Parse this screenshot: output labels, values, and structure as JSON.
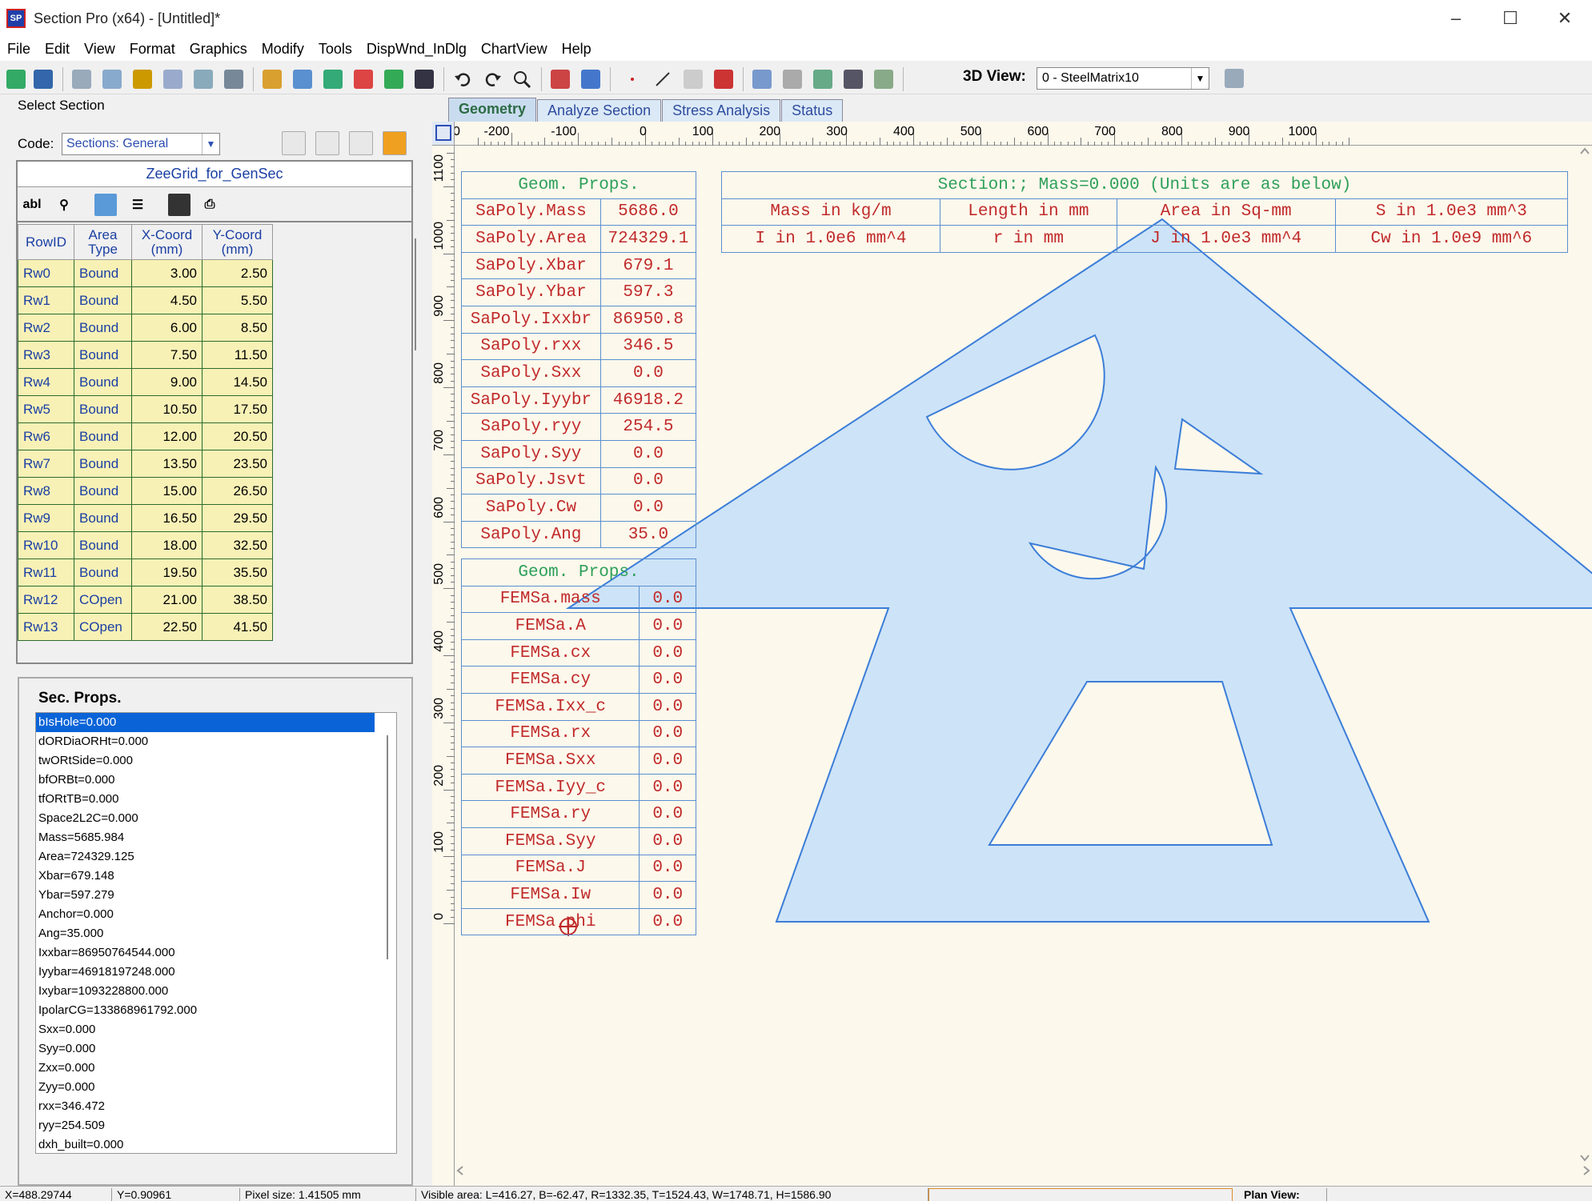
{
  "window": {
    "title": "Section Pro (x64) - [Untitled]*",
    "app_icon_text": "SP"
  },
  "menu": [
    "File",
    "Edit",
    "View",
    "Format",
    "Graphics",
    "Modify",
    "Tools",
    "DispWnd_InDlg",
    "ChartView",
    "Help"
  ],
  "toolbar": {
    "view3d_label": "3D View:",
    "view3d_value": "0 - SteelMatrix10"
  },
  "left": {
    "select_section": "Select Section",
    "code_label": "Code:",
    "code_value": "Sections: General",
    "grid_title": "ZeeGrid_for_GenSec",
    "grid_tool_text": "abl",
    "columns": [
      "RowID",
      "Area Type",
      "X-Coord (mm)",
      "Y-Coord (mm)"
    ],
    "rows": [
      [
        "Rw0",
        "Bound",
        "3.00",
        "2.50"
      ],
      [
        "Rw1",
        "Bound",
        "4.50",
        "5.50"
      ],
      [
        "Rw2",
        "Bound",
        "6.00",
        "8.50"
      ],
      [
        "Rw3",
        "Bound",
        "7.50",
        "11.50"
      ],
      [
        "Rw4",
        "Bound",
        "9.00",
        "14.50"
      ],
      [
        "Rw5",
        "Bound",
        "10.50",
        "17.50"
      ],
      [
        "Rw6",
        "Bound",
        "12.00",
        "20.50"
      ],
      [
        "Rw7",
        "Bound",
        "13.50",
        "23.50"
      ],
      [
        "Rw8",
        "Bound",
        "15.00",
        "26.50"
      ],
      [
        "Rw9",
        "Bound",
        "16.50",
        "29.50"
      ],
      [
        "Rw10",
        "Bound",
        "18.00",
        "32.50"
      ],
      [
        "Rw11",
        "Bound",
        "19.50",
        "35.50"
      ],
      [
        "Rw12",
        "COpen",
        "21.00",
        "38.50"
      ],
      [
        "Rw13",
        "COpen",
        "22.50",
        "41.50"
      ]
    ],
    "sec_props_title": "Sec. Props.",
    "sec_props": [
      "bIsHole=0.000",
      "dORDiaORHt=0.000",
      "twORtSide=0.000",
      "bfORBt=0.000",
      "tfORtTB=0.000",
      "Space2L2C=0.000",
      "Mass=5685.984",
      "Area=724329.125",
      "Xbar=679.148",
      "Ybar=597.279",
      "Anchor=0.000",
      "Ang=35.000",
      "Ixxbar=86950764544.000",
      "Iyybar=46918197248.000",
      "Ixybar=1093228800.000",
      "IpolarCG=133868961792.000",
      "Sxx=0.000",
      "Syy=0.000",
      "Zxx=0.000",
      "Zyy=0.000",
      "rxx=346.472",
      "ryy=254.509",
      "dxh_built=0.000"
    ]
  },
  "tabs": [
    "Geometry",
    "Analyze Section",
    "Stress Analysis",
    "Status"
  ],
  "ruler": {
    "x_labels": [
      "-200",
      "-100",
      "0",
      "100",
      "200",
      "300",
      "400",
      "500",
      "600",
      "700",
      "800",
      "900",
      "1000"
    ],
    "x_first_partial": "0",
    "y_labels": [
      "1100",
      "1000",
      "900",
      "800",
      "700",
      "600",
      "500",
      "400",
      "300",
      "200",
      "100",
      "0"
    ]
  },
  "props1": {
    "header": "Geom. Props.",
    "rows": [
      [
        "SaPoly.Mass",
        "5686.0"
      ],
      [
        "SaPoly.Area",
        "724329.1"
      ],
      [
        "SaPoly.Xbar",
        "679.1"
      ],
      [
        "SaPoly.Ybar",
        "597.3"
      ],
      [
        "SaPoly.Ixxbr",
        "86950.8"
      ],
      [
        "SaPoly.rxx",
        "346.5"
      ],
      [
        "SaPoly.Sxx",
        "0.0"
      ],
      [
        "SaPoly.Iyybr",
        "46918.2"
      ],
      [
        "SaPoly.ryy",
        "254.5"
      ],
      [
        "SaPoly.Syy",
        "0.0"
      ],
      [
        "SaPoly.Jsvt",
        "0.0"
      ],
      [
        "SaPoly.Cw",
        "0.0"
      ],
      [
        "SaPoly.Ang",
        "35.0"
      ]
    ]
  },
  "props2": {
    "header": "Geom. Props.",
    "rows": [
      [
        "FEMSa.mass",
        "0.0"
      ],
      [
        "FEMSa.A",
        "0.0"
      ],
      [
        "FEMSa.cx",
        "0.0"
      ],
      [
        "FEMSa.cy",
        "0.0"
      ],
      [
        "FEMSa.Ixx_c",
        "0.0"
      ],
      [
        "FEMSa.rx",
        "0.0"
      ],
      [
        "FEMSa.Sxx",
        "0.0"
      ],
      [
        "FEMSa.Iyy_c",
        "0.0"
      ],
      [
        "FEMSa.ry",
        "0.0"
      ],
      [
        "FEMSa.Syy",
        "0.0"
      ],
      [
        "FEMSa.J",
        "0.0"
      ],
      [
        "FEMSa.Iw",
        "0.0"
      ],
      [
        "FEMSa.phi",
        "0.0"
      ]
    ]
  },
  "units": {
    "header": "Section:; Mass=0.000 (Units are as below)",
    "row1": [
      "Mass in kg/m",
      "Length in mm",
      "Area in Sq-mm",
      "S in 1.0e3 mm^3"
    ],
    "row2": [
      "I in 1.0e6 mm^4",
      "r in mm",
      "J in 1.0e3 mm^4",
      "Cw in 1.0e9 mm^6"
    ]
  },
  "colors": {
    "section_fill": "#cde3f7",
    "section_stroke": "#3b7dd8",
    "prop_text": "#c02a2a",
    "prop_header": "#2ea05a",
    "grid_cell": "#f8f1b6"
  },
  "status": [
    "X=488.29744",
    "Y=0.90961",
    "Pixel size: 1.41505 mm",
    "Visible area: L=416.27, B=-62.47, R=1332.35, T=1524.43, W=1748.71, H=1586.90",
    "Plan View:"
  ]
}
